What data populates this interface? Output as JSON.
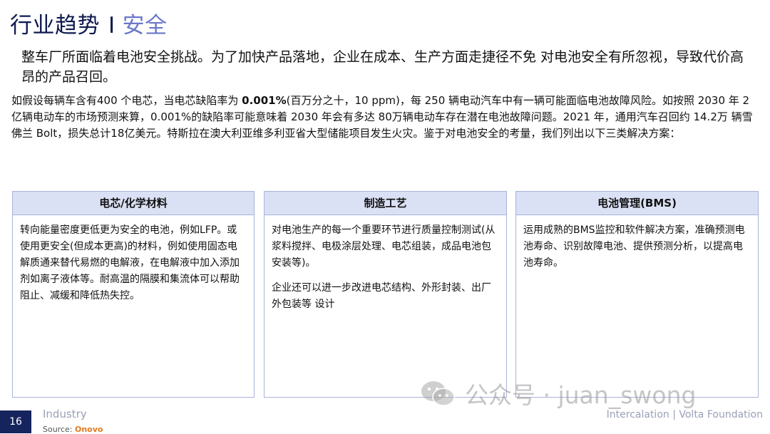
{
  "header": {
    "title": "行业趋势",
    "separator": "I",
    "topic": "安全"
  },
  "subtitle": "整车厂所面临着电池安全挑战。为了加快产品落地，企业在成本、生产方面走捷径不免 对电池安全有所忽视，导致代价高昂的产品召回。",
  "body": {
    "part1": "如假设每辆车含有400 个电芯，当电芯缺陷率为 ",
    "highlight": "0.001%",
    "part2": "(百万分之十，10 ppm)，每 250 辆电动汽车中有一辆可能面临电池故障风险。如按照 2030 年 2 亿辆电动车的市场预测来算，0.001%的缺陷率可能意味着 2030 年会有多达 80万辆电动车存在潜在电池故障问题。2021 年，通用汽车召回约 14.2万 辆雪佛兰 Bolt，损失总计18亿美元。特斯拉在澳大利亚维多利亚省大型储能项目发生火灾。鉴于对电池安全的考量，我们列出以下三类解决方案："
  },
  "cards": [
    {
      "title": "电芯/化学材料",
      "paragraphs": [
        "转向能量密度更低更为安全的电池，例如LFP。或使用更安全(但成本更高)的材料，例如使用固态电解质通来替代易燃的电解液，在电解液中加入添加剂如离子液体等。耐高温的隔膜和集流体可以帮助阻止、减缓和降低热失控。"
      ]
    },
    {
      "title": "制造工艺",
      "paragraphs": [
        "对电池生产的每一个重要环节进行质量控制测试(从浆料搅拌、电极涂层处理、电芯组装，成品电池包安装等)。",
        "企业还可以进一步改进电芯结构、外形封装、出厂外包装等 设计"
      ]
    },
    {
      "title": "电池管理(BMS)",
      "paragraphs": [
        "运用成熟的BMS监控和软件解决方案，准确预测电池寿命、识别故障电池、提供预测分析，以提高电池寿命。"
      ]
    }
  ],
  "footer": {
    "page_number": "16",
    "section": "Industry",
    "source_label": "Source:",
    "source_logo": "Onovo",
    "right": "Intercalation | Volta Foundation"
  },
  "watermark": {
    "text": "公众号 · juan_swong",
    "icon": "wechat-icon"
  },
  "colors": {
    "title": "#0f1a4f",
    "accent": "#6a78c9",
    "card_header_bg": "#dbe1f5",
    "card_border": "#a9b3d8",
    "footer_bar": "#16245e"
  }
}
